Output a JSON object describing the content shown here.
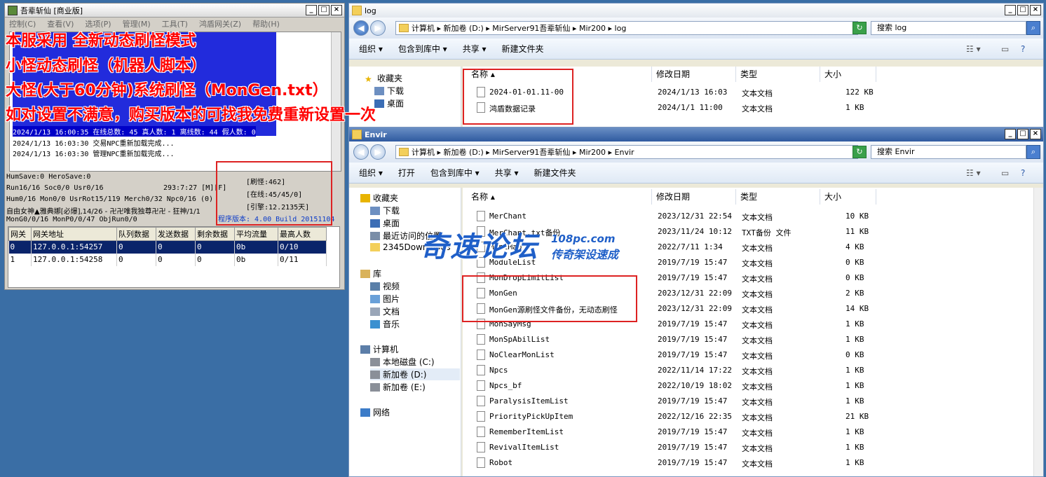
{
  "left_window": {
    "title": "吾辈斩仙 [商业版]",
    "menu": [
      "控制(C)",
      "查看(V)",
      "选项(P)",
      "管理(M)",
      "工具(T)",
      "鸿盾网关(Z)",
      "帮助(H)"
    ],
    "log_lines": [
      "2024/1/13 16:00:35 在线总数: 45 真人数: 1 离线数: 44 假人数: 0",
      "2024/1/13 16:03:30 交易NPC重新加载完成...",
      "2024/1/13 16:03:30 管理NPC重新加载完成..."
    ],
    "status": {
      "line1": "HumSave:0 HeroSave:0",
      "line2a": "Run16/16 Soc0/0 Usr0/16",
      "line2b": "293:7:27 [M][F]",
      "line3": "Hum0/16 Mon0/0 UsrRot15/119 Merch0/32 Npc0/16 (0)",
      "line4": "自由女神▲雅典娜[必爆],14/26 - 卍卍唯我独尊卍卍 - 狂神/1/1",
      "line5": "MonG0/0/16 MonP0/0/47 ObjRun0/0",
      "refresh": "[刷怪:462]",
      "online": "[在线:45/45/0]",
      "engine": "[引擎:12.2135天]",
      "version": "程序版本: 4.00 Build 20151104"
    },
    "gate_table": {
      "headers": [
        "网关",
        "网关地址",
        "队列数据",
        "发送数据",
        "剩余数据",
        "平均流量",
        "最高人数"
      ],
      "rows": [
        [
          "0",
          "127.0.0.1:54257",
          "0",
          "0",
          "0",
          "0b",
          "0/10"
        ],
        [
          "1",
          "127.0.0.1:54258",
          "0",
          "0",
          "0",
          "0b",
          "0/11"
        ]
      ]
    }
  },
  "overlay_text": [
    "本服采用 全新动态刷怪模式",
    "小怪动态刷怪（机器人脚本）",
    "大怪(大于60分钟)系统刷怪（MonGen.txt）",
    "如对设置不满意，购买版本的可找我免费重新设置一次"
  ],
  "log_window": {
    "title": "log",
    "address": [
      "计算机",
      "新加卷 (D:)",
      "MirServer91吾辈斩仙",
      "Mir200",
      "log"
    ],
    "search_placeholder": "搜索 log",
    "toolbar": [
      "组织 ▾",
      "包含到库中 ▾",
      "共享 ▾",
      "新建文件夹"
    ],
    "nav": [
      "收藏夹",
      "下载",
      "桌面"
    ],
    "columns": [
      "名称",
      "修改日期",
      "类型",
      "大小"
    ],
    "files": [
      {
        "name": "2024-01-01.11-00",
        "date": "2024/1/13 16:03",
        "type": "文本文档",
        "size": "122 KB"
      },
      {
        "name": "鸿盾数据记录",
        "date": "2024/1/1 11:00",
        "type": "文本文档",
        "size": "1 KB"
      }
    ]
  },
  "envir_window": {
    "title": "Envir",
    "address": [
      "计算机",
      "新加卷 (D:)",
      "MirServer91吾辈斩仙",
      "Mir200",
      "Envir"
    ],
    "search_placeholder": "搜索 Envir",
    "toolbar": [
      "组织 ▾",
      "打开",
      "包含到库中 ▾",
      "共享 ▾",
      "新建文件夹"
    ],
    "nav": [
      {
        "label": "收藏夹",
        "level": 0
      },
      {
        "label": "下载",
        "level": 1
      },
      {
        "label": "桌面",
        "level": 1
      },
      {
        "label": "最近访问的位置",
        "level": 1
      },
      {
        "label": "2345Downloads",
        "level": 1
      },
      {
        "label": "库",
        "level": 0
      },
      {
        "label": "视频",
        "level": 1
      },
      {
        "label": "图片",
        "level": 1
      },
      {
        "label": "文档",
        "level": 1
      },
      {
        "label": "音乐",
        "level": 1
      },
      {
        "label": "计算机",
        "level": 0
      },
      {
        "label": "本地磁盘 (C:)",
        "level": 1
      },
      {
        "label": "新加卷 (D:)",
        "level": 1
      },
      {
        "label": "新加卷 (E:)",
        "level": 1
      },
      {
        "label": "网络",
        "level": 0
      }
    ],
    "columns": [
      "名称",
      "修改日期",
      "类型",
      "大小"
    ],
    "files": [
      {
        "name": "MerChant",
        "date": "2023/12/31 22:54",
        "type": "文本文档",
        "size": "10 KB"
      },
      {
        "name": "MerChant.txt备份",
        "date": "2023/11/24 10:12",
        "type": "TXT备份 文件",
        "size": "11 KB"
      },
      {
        "name": "MiniMap",
        "date": "2022/7/11 1:34",
        "type": "文本文档",
        "size": "4 KB"
      },
      {
        "name": "ModuleList",
        "date": "2019/7/19 15:47",
        "type": "文本文档",
        "size": "0 KB"
      },
      {
        "name": "MonDropLimitList",
        "date": "2019/7/19 15:47",
        "type": "文本文档",
        "size": "0 KB"
      },
      {
        "name": "MonGen",
        "date": "2023/12/31 22:09",
        "type": "文本文档",
        "size": "2 KB"
      },
      {
        "name": "MonGen源刷怪文件备份，无动态刷怪",
        "date": "2023/12/31 22:09",
        "type": "文本文档",
        "size": "14 KB"
      },
      {
        "name": "MonSayMsg",
        "date": "2019/7/19 15:47",
        "type": "文本文档",
        "size": "1 KB"
      },
      {
        "name": "MonSpAbilList",
        "date": "2019/7/19 15:47",
        "type": "文本文档",
        "size": "1 KB"
      },
      {
        "name": "NoClearMonList",
        "date": "2019/7/19 15:47",
        "type": "文本文档",
        "size": "0 KB"
      },
      {
        "name": "Npcs",
        "date": "2022/11/14 17:22",
        "type": "文本文档",
        "size": "1 KB"
      },
      {
        "name": "Npcs_bf",
        "date": "2022/10/19 18:02",
        "type": "文本文档",
        "size": "1 KB"
      },
      {
        "name": "ParalysisItemList",
        "date": "2019/7/19 15:47",
        "type": "文本文档",
        "size": "1 KB"
      },
      {
        "name": "PriorityPickUpItem",
        "date": "2022/12/16 22:35",
        "type": "文本文档",
        "size": "21 KB"
      },
      {
        "name": "RememberItemList",
        "date": "2019/7/19 15:47",
        "type": "文本文档",
        "size": "1 KB"
      },
      {
        "name": "RevivalItemList",
        "date": "2019/7/19 15:47",
        "type": "文本文档",
        "size": "1 KB"
      },
      {
        "name": "Robot",
        "date": "2019/7/19 15:47",
        "type": "文本文档",
        "size": "1 KB"
      }
    ]
  },
  "watermark": {
    "main": "奇速论坛",
    "site": "108pc.com",
    "tagline": "传奇架设速成"
  },
  "colors": {
    "overlay_red": "#ff0000",
    "highlight_box": "#dd2222",
    "watermark_blue": "#1f5fc8"
  }
}
